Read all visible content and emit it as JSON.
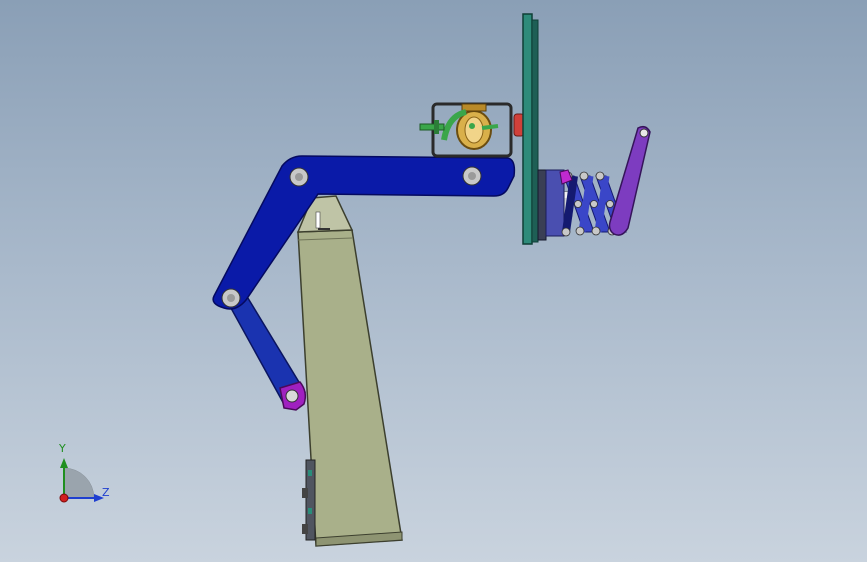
{
  "viewport": {
    "background_top": "#8a9fb6",
    "background_bottom": "#c9d3de"
  },
  "model": {
    "colors": {
      "arm_blue": "#0a1aa8",
      "base_olive": "#a9b08a",
      "panel_teal": "#2e8b7a",
      "pivot_purple": "#a020c0",
      "spring_blue": "#3a46c8",
      "lever_purple": "#7d3cc0",
      "gimbal_gold": "#c99a2e",
      "hose_green": "#3aa64a",
      "knob_red": "#d0403a"
    },
    "parts": [
      "upper-arm",
      "lower-arm",
      "base-column",
      "mount-plate",
      "gimbal-frame",
      "spring-assembly",
      "lever",
      "pivot-bracket"
    ]
  },
  "triad": {
    "y_label": "Y",
    "z_label": "Z",
    "y_color": "#1f8f1f",
    "z_color": "#1f3fd0",
    "x_color": "#d01f1f"
  }
}
